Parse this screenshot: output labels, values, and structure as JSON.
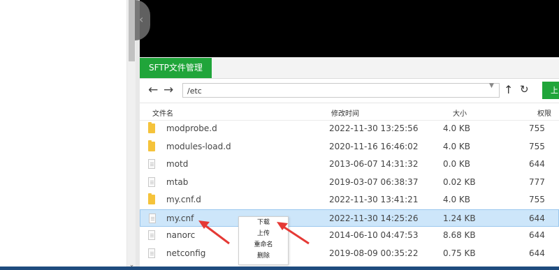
{
  "sftp": {
    "tab_label": "SFTP文件管理",
    "path_value": "/etc",
    "upload_label": "上"
  },
  "icons": {
    "back": "arrow-left-icon",
    "forward": "arrow-right-icon",
    "up": "arrow-up-icon",
    "refresh": "refresh-icon",
    "folder": "folder-icon",
    "file": "file-icon"
  },
  "table": {
    "headers": {
      "name": "文件名",
      "mtime": "修改时间",
      "size": "大小",
      "perm": "权限"
    },
    "rows": [
      {
        "icon": "folder",
        "name": "modprobe.d",
        "mtime": "2022-11-30 13:25:56",
        "size": "4.0 KB",
        "perm": "755"
      },
      {
        "icon": "folder",
        "name": "modules-load.d",
        "mtime": "2020-11-16 16:46:02",
        "size": "4.0 KB",
        "perm": "755"
      },
      {
        "icon": "file",
        "name": "motd",
        "mtime": "2013-06-07 14:31:32",
        "size": "0.0 KB",
        "perm": "644"
      },
      {
        "icon": "file",
        "name": "mtab",
        "mtime": "2019-03-07 06:38:37",
        "size": "0.02 KB",
        "perm": "777"
      },
      {
        "icon": "folder",
        "name": "my.cnf.d",
        "mtime": "2022-11-30 13:41:21",
        "size": "4.0 KB",
        "perm": "755"
      },
      {
        "icon": "file",
        "name": "my.cnf",
        "mtime": "2022-11-30 14:25:26",
        "size": "1.24 KB",
        "perm": "644",
        "selected": true
      },
      {
        "icon": "file",
        "name": "nanorc",
        "mtime": "2014-06-10 04:47:53",
        "size": "8.68 KB",
        "perm": "644"
      },
      {
        "icon": "file",
        "name": "netconfig",
        "mtime": "2019-08-09 00:35:22",
        "size": "0.75 KB",
        "perm": "644"
      }
    ]
  },
  "context_menu": [
    "下载",
    "上传",
    "重命名",
    "删除"
  ],
  "colors": {
    "accent": "#20a53a",
    "selection": "#cde6fa",
    "annotation": "#e53935",
    "terminal": "#000000"
  }
}
